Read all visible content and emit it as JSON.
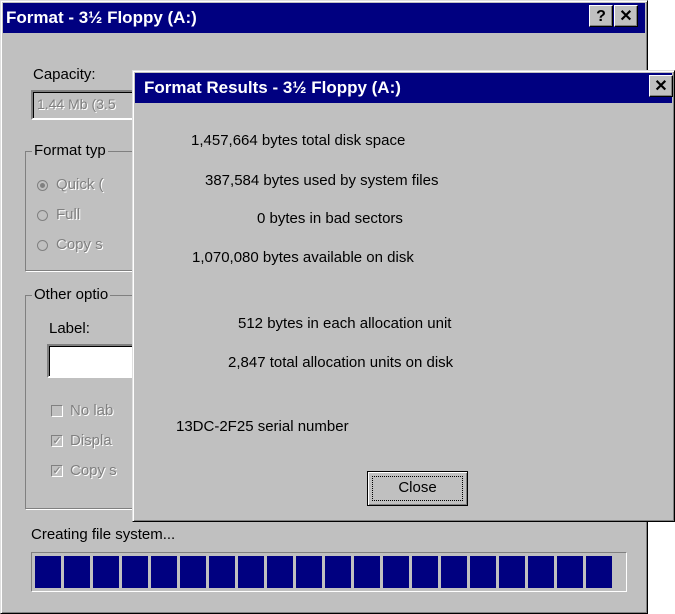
{
  "format_window": {
    "title": "Format - 3½ Floppy (A:)",
    "help_button": "?",
    "close_button": "✕",
    "capacity_label": "Capacity:",
    "capacity_value": "1.44 Mb (3.5",
    "format_type_legend": "Format typ",
    "radio_quick": "Quick (",
    "radio_full": "Full",
    "radio_copy": "Copy s",
    "other_options_legend": "Other optio",
    "label_label": "Label:",
    "label_value": "",
    "check_no_label": "No lab",
    "check_display": "Displa",
    "check_copy": "Copy s",
    "status_text": "Creating file system...",
    "progress_segments": 20
  },
  "results_window": {
    "title": "Format Results - 3½ Floppy (A:)",
    "close_button": "✕",
    "total_space": "1,457,664 bytes total disk space",
    "system_files": "387,584 bytes used by system files",
    "bad_sectors": "0 bytes in bad sectors",
    "available": "1,070,080 bytes available on disk",
    "alloc_unit": "512 bytes in each allocation unit",
    "alloc_total": "2,847 total allocation units on disk",
    "serial": "13DC-2F25 serial number",
    "close_label": "Close"
  },
  "colors": {
    "title_bar": "#000080",
    "face": "#c0c0c0",
    "progress_fill": "#000080"
  }
}
